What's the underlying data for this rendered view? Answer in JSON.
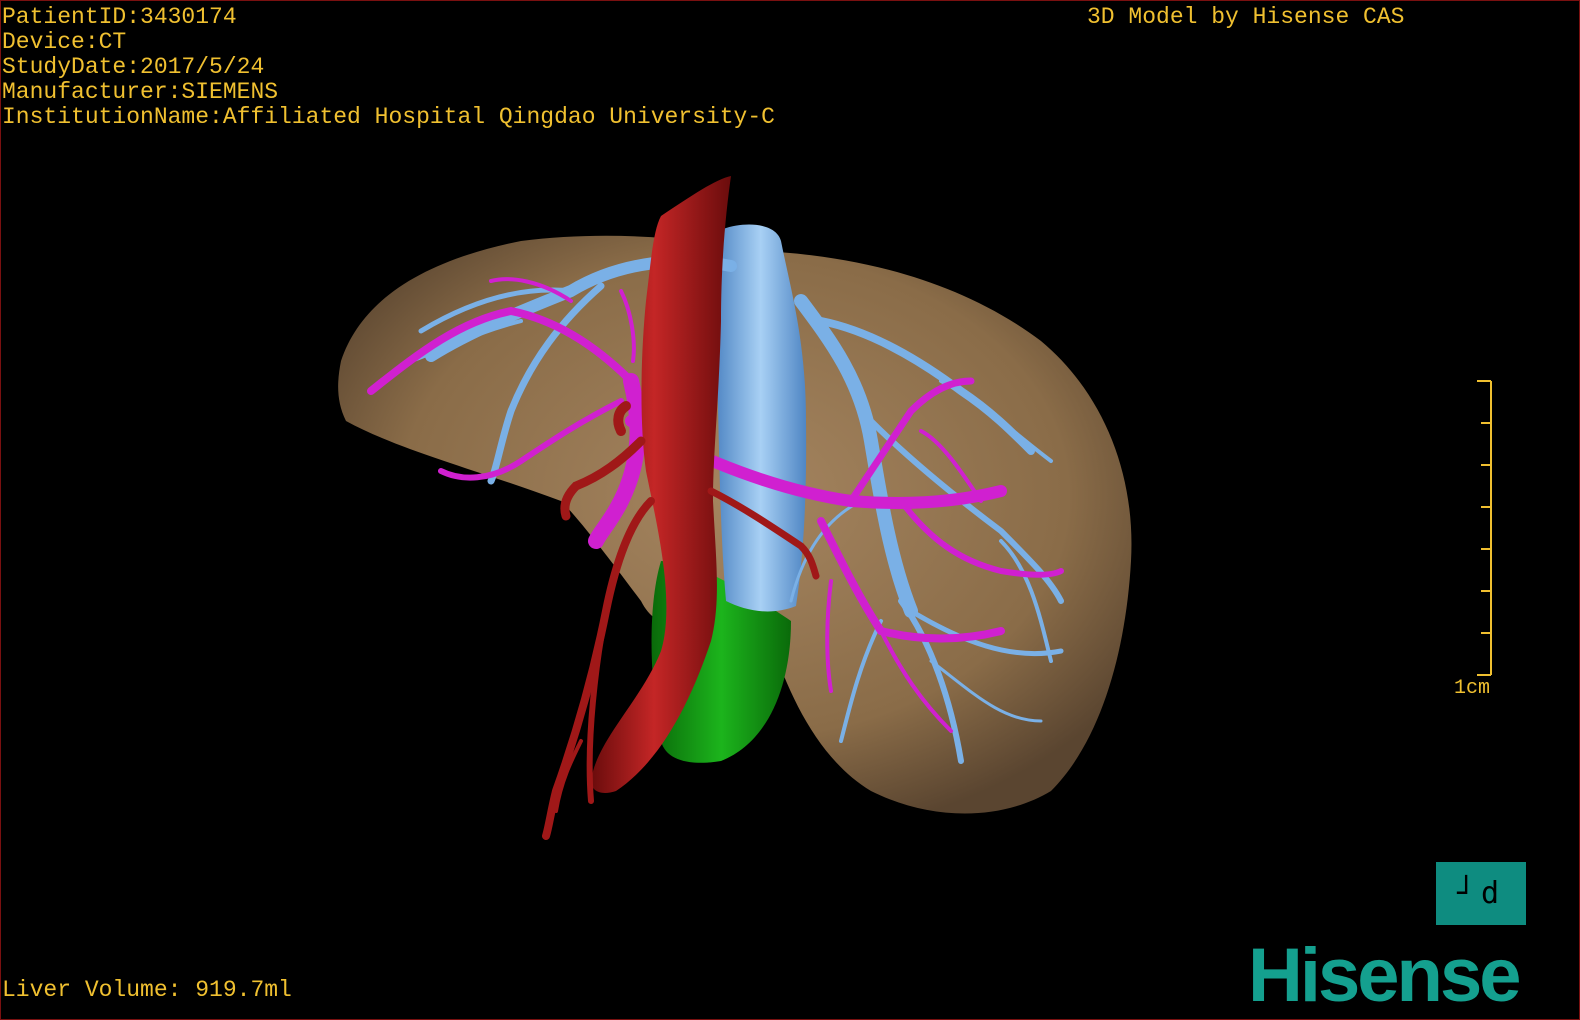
{
  "patient_info": {
    "patient_id": "PatientID:3430174",
    "device": "Device:CT",
    "study_date": "StudyDate:2017/5/24",
    "manufacturer": "Manufacturer:SIEMENS",
    "institution": "InstitutionName:Affiliated Hospital Qingdao University-C"
  },
  "model_credit": "3D Model by Hisense CAS",
  "liver_volume": "Liver Volume: 919.7ml",
  "scale_bar": {
    "label": "1cm"
  },
  "view_cube": {
    "glyphs": "┘d"
  },
  "brand": "Hisense",
  "colors": {
    "overlay_text": "#f0c030",
    "liver": "#8c6e4a",
    "hepatic_artery": "#a01818",
    "inferior_vena_cava": "#78aee0",
    "portal_vein": "#d020d0",
    "green_segment": "#139a13",
    "brand": "#14a08f"
  },
  "structures": [
    "liver",
    "aorta",
    "inferior-vena-cava",
    "hepatic-veins",
    "portal-vein",
    "green-segment"
  ]
}
